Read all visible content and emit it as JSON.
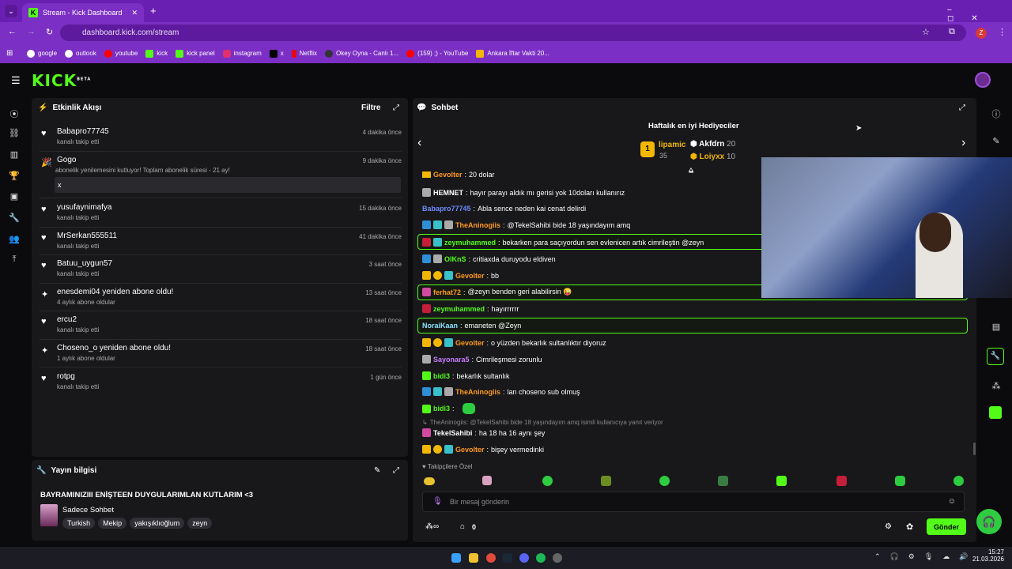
{
  "browser": {
    "tab_title": "Stream - Kick Dashboard",
    "url": "dashboard.kick.com/stream",
    "bookmarks": [
      "google",
      "outlook",
      "youtube",
      "kick",
      "kick panel",
      "instagram",
      "x",
      "Netflix",
      "Okey Oyna - Canlı 1...",
      "(159) ;) - YouTube",
      "Ankara İftar Vakti 20..."
    ]
  },
  "header": {
    "logo": "KICK",
    "beta": "BETA"
  },
  "activity": {
    "title": "Etkinlik Akışı",
    "filter": "Filtre",
    "items": [
      {
        "name": "Babapro77745",
        "sub": "kanalı takip etti",
        "time": "4 dakika önce"
      },
      {
        "name": "Gogo",
        "sub": "abonelik yenilemesini kutluyor! Toplam abonelik süresi - 21 ay!",
        "time": "9 dakika önce",
        "box": "x"
      },
      {
        "name": "yusufaynimafya",
        "sub": "kanalı takip etti",
        "time": "15 dakika önce"
      },
      {
        "name": "MrSerkan555511",
        "sub": "kanalı takip etti",
        "time": "41 dakika önce"
      },
      {
        "name": "Batuu_uygun57",
        "sub": "kanalı takip etti",
        "time": "3 saat önce"
      },
      {
        "name": "enesdemi04 yeniden abone oldu!",
        "sub": "4 aylık abone oldular",
        "time": "13 saat önce"
      },
      {
        "name": "ercu2",
        "sub": "kanalı takip etti",
        "time": "18 saat önce"
      },
      {
        "name": "Choseno_o yeniden abone oldu!",
        "sub": "1 aylık abone oldular",
        "time": "18 saat önce"
      },
      {
        "name": "rotpg",
        "sub": "kanalı takip etti",
        "time": "1 gün önce"
      }
    ]
  },
  "info": {
    "title": "Yayın bilgisi",
    "stream_title": "BAYRAMINIZIII ENİŞTEEN DUYGULARIMLAN KUTLARIM <3",
    "category": "Sadece Sohbet",
    "tags": [
      "Turkish",
      "Mekip",
      "yakışıklıoğlum",
      "zeyn"
    ]
  },
  "chat": {
    "title": "Sohbet",
    "gifters_title": "Haftalık en iyi Hediyeciler",
    "top_gifter": {
      "name": "lipamic",
      "count": "35",
      "rank": "1"
    },
    "gifters": [
      {
        "name": "Akfdrn",
        "count": "20"
      },
      {
        "name": "Loiyxx",
        "count": "10"
      }
    ],
    "messages": [
      {
        "user": "Gevolter",
        "text": "20 dolar",
        "color": "#ff9a1f"
      },
      {
        "user": "HEMNET",
        "text": "hayır parayı aldık mı gerisi yok 10doları kullanırız",
        "color": "#ffffff"
      },
      {
        "user": "Babapro77745",
        "text": "Abla sence neden kai cenat delirdi",
        "color": "#6d8cff"
      },
      {
        "user": "TheAninogiis",
        "text": "@TekelSahibi bide 18 yaşındayım amq",
        "color": "#ff9a1f"
      },
      {
        "user": "zeymuhammed",
        "text": "bekarken para saçıyordun sen evlenicen artık cimrileştin @zeyn",
        "color": "#53fc18"
      },
      {
        "user": "OlKnS",
        "text": "critiaxda duruyodu eldiven",
        "color": "#53fc18"
      },
      {
        "user": "Gevolter",
        "text": "bb",
        "color": "#ff9a1f"
      },
      {
        "user": "ferhat72",
        "text": "@zeyn benden geri alabilirsin 😜",
        "color": "#ff9a1f"
      },
      {
        "user": "zeymuhammed",
        "text": "hayırrrrrr",
        "color": "#53fc18"
      },
      {
        "user": "NoraiKaan",
        "text": "emaneten @Zeyn",
        "color": "#8be0ff"
      },
      {
        "user": "Gevolter",
        "text": "o yüzden bekarlık sultanlıktır diyoruz",
        "color": "#ff9a1f"
      },
      {
        "user": "Sayonara5",
        "text": "Cimrileşmesi zorunlu",
        "color": "#c77dff"
      },
      {
        "user": "bidi3",
        "text": "bekarlık sultanlık",
        "color": "#53fc18"
      },
      {
        "user": "TheAninogiis",
        "text": "lan choseno sub olmuş",
        "color": "#ff9a1f"
      },
      {
        "user": "bidi3",
        "text": "",
        "color": "#53fc18"
      },
      {
        "user": "TekelSahibi",
        "text": "ha 18 ha 16 aynı şey",
        "color": "#ffffff",
        "reply": "TheAninogiis: @TekelSahibi bide 18 yaşındayım amq isimli kullanıcıya yanıt veriyor"
      },
      {
        "user": "Gevolter",
        "text": "bişey vermedinki",
        "color": "#ff9a1f"
      }
    ],
    "followers_only": "Takipçilere Özel",
    "input_placeholder": "Bir mesaj gönderin",
    "points": "0",
    "send": "Gönder"
  },
  "taskbar": {
    "time": "15:27",
    "date": "21.03.2026"
  }
}
